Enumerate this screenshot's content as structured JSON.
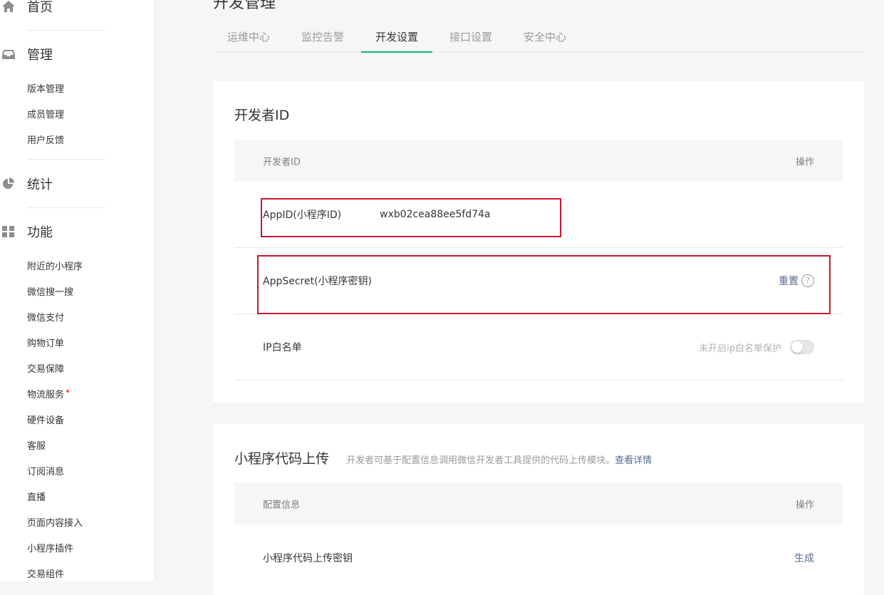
{
  "sidebar": {
    "home": "首页",
    "manage": {
      "title": "管理",
      "items": [
        "版本管理",
        "成员管理",
        "用户反馈"
      ]
    },
    "stats": "统计",
    "features": {
      "title": "功能",
      "items": [
        "附近的小程序",
        "微信搜一搜",
        "微信支付",
        "购物订单",
        "交易保障",
        "物流服务",
        "硬件设备",
        "客服",
        "订阅消息",
        "直播",
        "页面内容接入",
        "小程序插件",
        "交易组件"
      ]
    }
  },
  "page_title": "开发管理",
  "tabs": [
    {
      "label": "运维中心",
      "active": false
    },
    {
      "label": "监控告警",
      "active": false
    },
    {
      "label": "开发设置",
      "active": true
    },
    {
      "label": "接口设置",
      "active": false
    },
    {
      "label": "安全中心",
      "active": false
    }
  ],
  "developer_card": {
    "title": "开发者ID",
    "header": {
      "col1": "开发者ID",
      "col2": "操作"
    },
    "appid": {
      "label": "AppID(小程序ID)",
      "value": "wxb02cea88ee5fd74a"
    },
    "appsecret": {
      "label": "AppSecret(小程序密钥)",
      "action": "重置",
      "help": "?"
    },
    "ip_whitelist": {
      "label": "IP白名单",
      "status": "未开启ip白名单保护",
      "enabled": false
    }
  },
  "upload_card": {
    "title": "小程序代码上传",
    "desc": "开发者可基于配置信息调用微信开发者工具提供的代码上传模块。",
    "desc_link": "查看详情",
    "header": {
      "col1": "配置信息",
      "col2": "操作"
    },
    "row": {
      "label": "小程序代码上传密钥",
      "action": "生成"
    }
  },
  "colors": {
    "accent": "#07c160",
    "link": "#576b95",
    "highlight": "#d0142c",
    "badge": "#fa5151"
  }
}
